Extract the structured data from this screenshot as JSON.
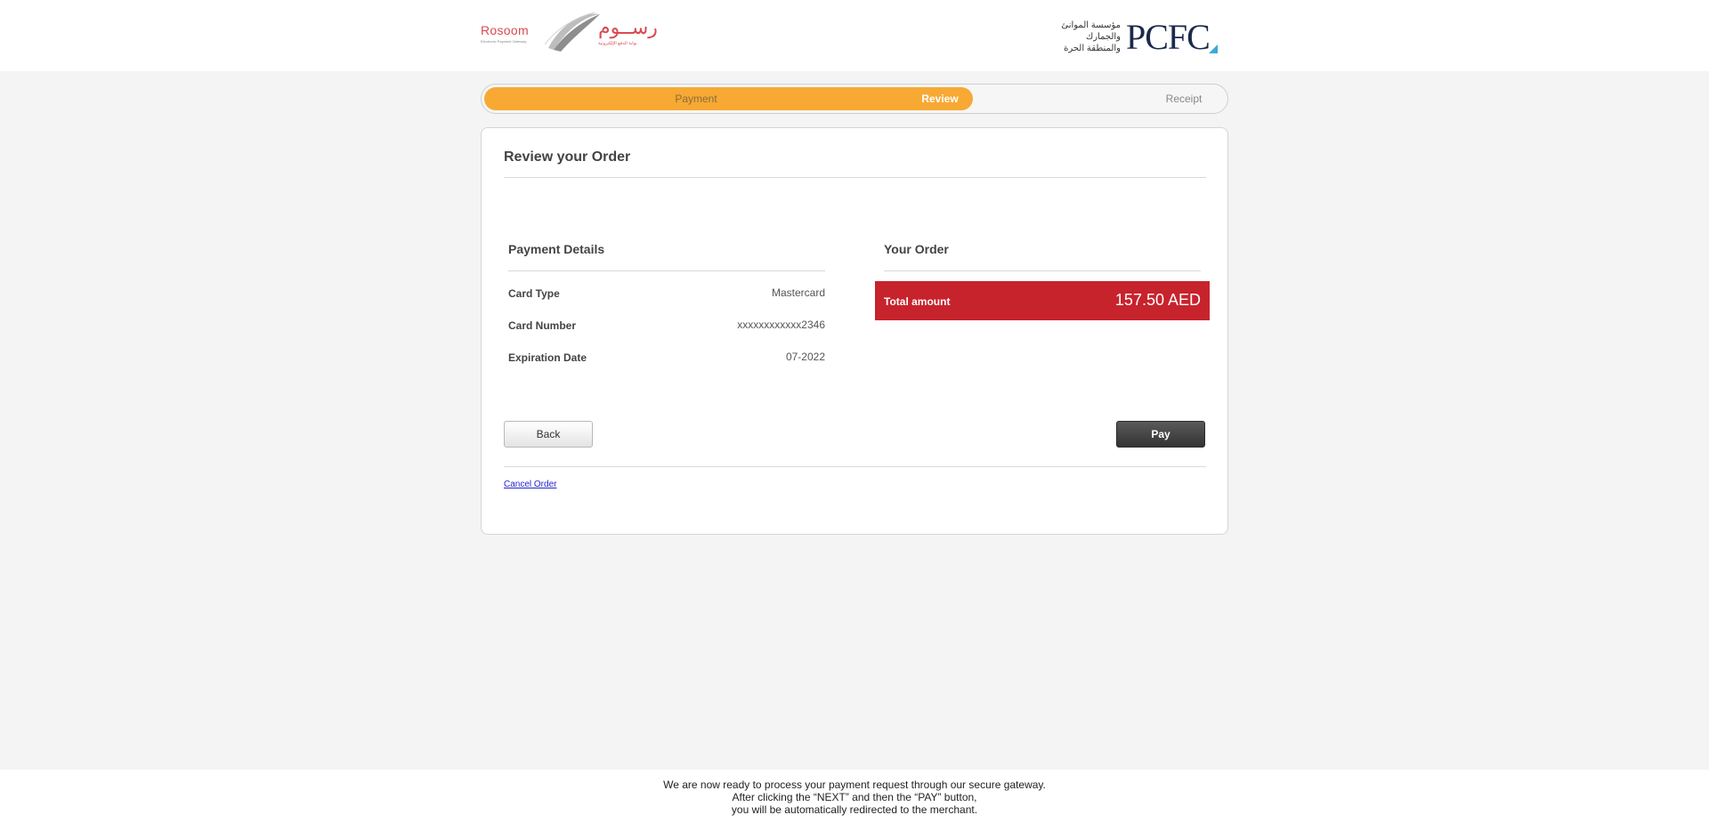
{
  "header": {
    "rosoom_logo": {
      "name_en": "Rosoom",
      "tagline_en": "Electronic Payment Gateway",
      "name_ar": "رســوم",
      "tagline_ar": "بوابة الدفع الإلكترونية"
    },
    "pcfc_logo": {
      "name": "PCFC",
      "name_ar": "مؤسسة الموانئ والجمارك والمنطقة الحرة",
      "accent_color": "#3aa9d9",
      "text_color": "#1b2a49"
    }
  },
  "steps": {
    "items": [
      "Payment",
      "Review",
      "Receipt"
    ],
    "active": "Review",
    "progress_color": "#f7a934"
  },
  "review": {
    "title": "Review your Order",
    "payment_details": {
      "title": "Payment Details",
      "fields": [
        {
          "label": "Card Type",
          "value": "Mastercard"
        },
        {
          "label": "Card Number",
          "value": "xxxxxxxxxxxx2346"
        },
        {
          "label": "Expiration Date",
          "value": "07-2022"
        }
      ]
    },
    "your_order": {
      "title": "Your Order",
      "total_label": "Total amount",
      "total_value": "157.50 AED",
      "total_bg_color": "#c7232d"
    },
    "back_label": "Back",
    "pay_label": "Pay",
    "cancel_label": "Cancel Order"
  },
  "footer": {
    "line1": "We are now ready to process your payment request through our secure gateway.",
    "line2": "After clicking the “NEXT” and then the “PAY” button,",
    "line3": "you will be automatically redirected to the merchant."
  }
}
